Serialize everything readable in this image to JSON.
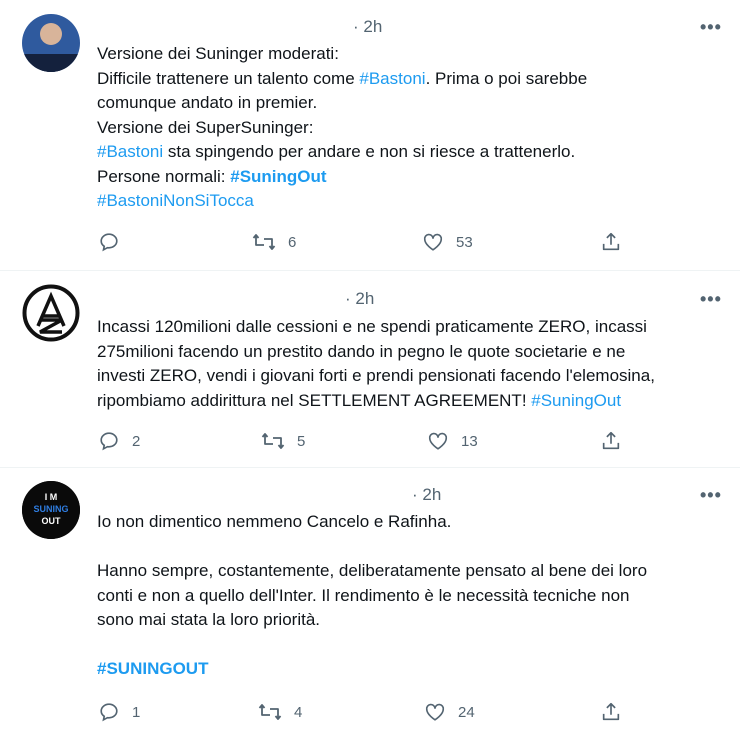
{
  "tweets": [
    {
      "time": "· 2h",
      "lines": [
        [
          {
            "t": "Versione dei Suninger moderati:"
          }
        ],
        [
          {
            "t": "Difficile trattenere un talento come "
          },
          {
            "t": "#Bastoni",
            "c": "blue"
          },
          {
            "t": ". Prima o poi sarebbe"
          }
        ],
        [
          {
            "t": "comunque andato in premier."
          }
        ],
        [
          {
            "t": "Versione dei SuperSuninger:"
          }
        ],
        [
          {
            "t": "#Bastoni",
            "c": "blue"
          },
          {
            "t": " sta spingendo per andare e non si riesce a trattenerlo."
          }
        ],
        [
          {
            "t": "Persone normali: "
          },
          {
            "t": "#SuningOut",
            "c": "blue bold"
          }
        ],
        [
          {
            "t": "#BastoniNonSiTocca",
            "c": "blue"
          }
        ]
      ],
      "reply_count": "",
      "retweet_count": "6",
      "like_count": "53"
    },
    {
      "time": "· 2h",
      "lines": [
        [
          {
            "t": "Incassi 120milioni dalle cessioni e ne spendi praticamente ZERO, incassi"
          }
        ],
        [
          {
            "t": "275milioni facendo un prestito dando in pegno le quote societarie e ne"
          }
        ],
        [
          {
            "t": "investi ZERO, vendi i giovani forti e prendi pensionati facendo l'elemosina,"
          }
        ],
        [
          {
            "t": "ripombiamo addirittura nel SETTLEMENT AGREEMENT! "
          },
          {
            "t": "#SuningOut",
            "c": "blue"
          }
        ]
      ],
      "reply_count": "2",
      "retweet_count": "5",
      "like_count": "13"
    },
    {
      "time": "· 2h",
      "avatar_text": [
        "I M",
        "SUNING",
        "OUT"
      ],
      "lines": [
        [
          {
            "t": "Io non dimentico nemmeno Cancelo e Rafinha."
          }
        ],
        [],
        [
          {
            "t": "Hanno sempre, costantemente, deliberatamente pensato al bene dei loro"
          }
        ],
        [
          {
            "t": "conti e non a quello dell'Inter. Il rendimento è le necessità tecniche non"
          }
        ],
        [
          {
            "t": "sono mai stata la loro priorità."
          }
        ],
        [],
        [
          {
            "t": "#SUNINGOUT",
            "c": "blue bold"
          }
        ]
      ],
      "reply_count": "1",
      "retweet_count": "4",
      "like_count": "24"
    }
  ],
  "more_label": "•••",
  "icons": [
    "reply-icon",
    "retweet-icon",
    "like-icon",
    "share-icon"
  ],
  "colors": {
    "link": "#1d9bf0",
    "text": "#0f1419",
    "muted": "#536471",
    "divider": "#eff3f4"
  }
}
